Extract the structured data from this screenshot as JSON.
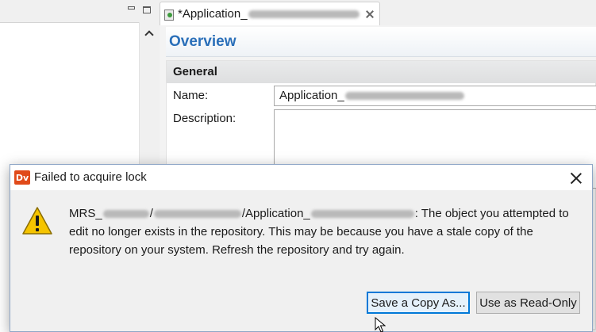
{
  "left_view": {
    "minimize_icon": "minimize-icon",
    "maximize_icon": "maximize-icon",
    "scroll_up_icon": "chevron-up-icon"
  },
  "editor": {
    "tab": {
      "title_prefix": "*Application_",
      "close_icon": "close-icon"
    },
    "overview_title": "Overview",
    "general": {
      "title": "General",
      "name_label": "Name:",
      "name_value_prefix": "Application_",
      "description_label": "Description:"
    }
  },
  "dialog": {
    "app_icon_text": "Dv",
    "title": "Failed to acquire lock",
    "message": {
      "path_prefix": "MRS_",
      "path_mid1": "/",
      "path_mid2": "/Application_",
      "text": ": The object you attempted to edit no longer exists in the repository. This may be because you have a stale copy of the repository on your system. Refresh the repository and try again."
    },
    "buttons": {
      "save_copy": "Save a Copy As...",
      "read_only": "Use as Read-Only"
    }
  },
  "colors": {
    "accent": "#0078d7",
    "overview_title": "#2a6fb9",
    "dv_icon": "#e04a1a",
    "warning": "#f5c400"
  }
}
